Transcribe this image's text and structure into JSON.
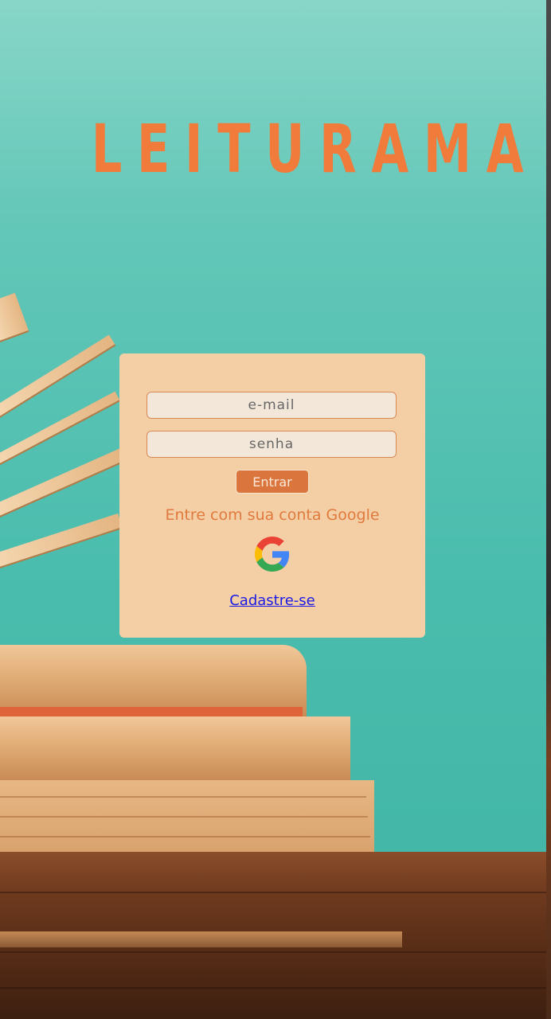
{
  "app": {
    "title": "LEITURAMA"
  },
  "login": {
    "email_placeholder": "e-mail",
    "email_value": "",
    "password_placeholder": "senha",
    "password_value": "",
    "enter_label": "Entrar",
    "google_text": "Entre com sua conta Google",
    "google_icon": "google-logo-icon",
    "signup_label": "Cadastre-se"
  },
  "colors": {
    "title": "#f07b3a",
    "card_background": "#f4cfa6",
    "enter_button": "#d9753d",
    "link": "#1a1ae6",
    "background": "#4bbdae"
  }
}
